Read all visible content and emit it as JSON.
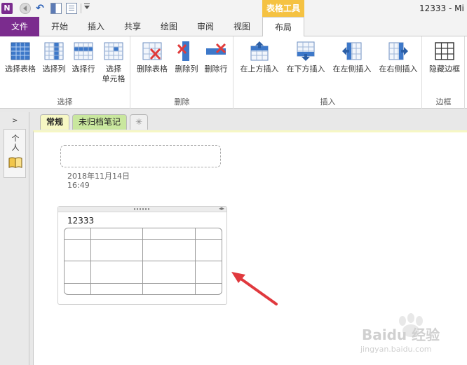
{
  "titlebar": {
    "app_glyph": "N",
    "title": "12333  -  Mi"
  },
  "contextual_group": "表格工具",
  "tabs": [
    {
      "label": "文件"
    },
    {
      "label": "开始"
    },
    {
      "label": "插入"
    },
    {
      "label": "共享"
    },
    {
      "label": "绘图"
    },
    {
      "label": "审阅"
    },
    {
      "label": "视图"
    },
    {
      "label": "布局"
    }
  ],
  "ribbon": {
    "select": {
      "label": "选择",
      "buttons": [
        "选择表格",
        "选择列",
        "选择行",
        "选择\n单元格"
      ]
    },
    "delete": {
      "label": "删除",
      "buttons": [
        "删除表格",
        "删除列",
        "删除行"
      ]
    },
    "insert": {
      "label": "插入",
      "buttons": [
        "在上方插入",
        "在下方插入",
        "在左侧插入",
        "在右侧插入"
      ]
    },
    "borders": {
      "label": "边框",
      "buttons": [
        "隐藏边框"
      ]
    }
  },
  "navigation": {
    "expand_glyph": ">",
    "notebook_label": "个人"
  },
  "section_tabs": [
    {
      "label": "常规"
    },
    {
      "label": "未归档笔记"
    },
    {
      "label": "✳"
    }
  ],
  "page": {
    "date": "2018年11月14日",
    "time": "16:49",
    "outline_title": "12333",
    "table": {
      "rows": 4,
      "cols": 4
    }
  },
  "watermark": {
    "text": "Baidu 经验",
    "sub": "jingyan.baidu.com"
  },
  "colors": {
    "file_tab": "#7b2c8e",
    "contextual": "#f5c242",
    "section_general": "#f6f7c4",
    "section_unfiled": "#c9e79e",
    "arrow": "#e0393e"
  }
}
